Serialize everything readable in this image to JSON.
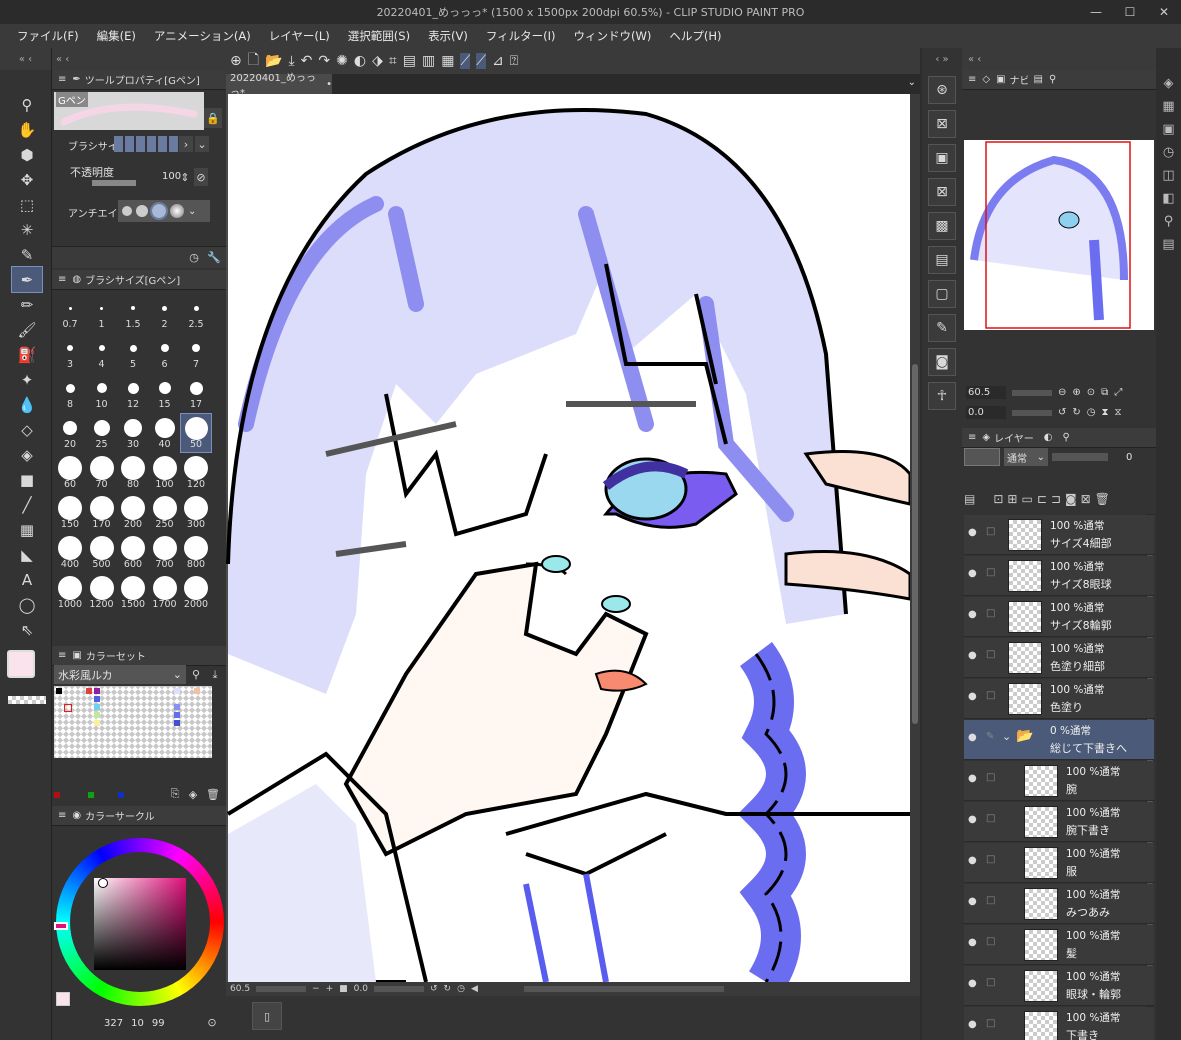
{
  "window": {
    "title": "20220401_めっっっ* (1500 x 1500px 200dpi 60.5%)  - CLIP STUDIO PAINT PRO"
  },
  "menu": [
    "ファイル(F)",
    "編集(E)",
    "アニメーション(A)",
    "レイヤー(L)",
    "選択範囲(S)",
    "表示(V)",
    "フィルター(I)",
    "ウィンドウ(W)",
    "ヘルプ(H)"
  ],
  "canvas_tab": {
    "label": "20220401_めっっっ*"
  },
  "tool_property": {
    "title": "ツールプロパティ[Gペン]",
    "preset_name": "Gペン",
    "brush_size_label": "ブラシサイズ",
    "opacity_label": "不透明度",
    "opacity_value": "100",
    "antialias_label": "アンチエイリアス"
  },
  "brush_size_panel": {
    "title": "ブラシサイズ[Gペン]",
    "sizes": [
      "0.7",
      "1",
      "1.5",
      "2",
      "2.5",
      "3",
      "4",
      "5",
      "6",
      "7",
      "8",
      "10",
      "12",
      "15",
      "17",
      "20",
      "25",
      "30",
      "40",
      "50",
      "60",
      "70",
      "80",
      "100",
      "120",
      "150",
      "170",
      "200",
      "250",
      "300",
      "400",
      "500",
      "600",
      "700",
      "800",
      "1000",
      "1200",
      "1500",
      "1700",
      "2000"
    ],
    "selected": "50"
  },
  "color_set": {
    "title": "カラーセット",
    "set_name": "水彩風ルカ"
  },
  "color_circle": {
    "title": "カラーサークル",
    "info": "327",
    "saturation": "10",
    "value": "99"
  },
  "navigator": {
    "tab": "ナビゲーター",
    "zoom": "60.5",
    "rotation": "0.0"
  },
  "layers": {
    "title": "レイヤー",
    "blend_mode": "通常",
    "opacity": "0",
    "items": [
      {
        "line1": "100 %通常",
        "line2": "サイズ4細部",
        "indent": false,
        "folder": false
      },
      {
        "line1": "100 %通常",
        "line2": "サイズ8眼球",
        "indent": false,
        "folder": false
      },
      {
        "line1": "100 %通常",
        "line2": "サイズ8輪郭",
        "indent": false,
        "folder": false
      },
      {
        "line1": "100 %通常",
        "line2": "色塗り細部",
        "indent": false,
        "folder": false
      },
      {
        "line1": "100 %通常",
        "line2": "色塗り",
        "indent": false,
        "folder": false
      },
      {
        "line1": "0 %通常",
        "line2": "総じて下書きへ",
        "indent": false,
        "folder": true
      },
      {
        "line1": "100 %通常",
        "line2": "腕",
        "indent": true,
        "folder": false
      },
      {
        "line1": "100 %通常",
        "line2": "腕下書き",
        "indent": true,
        "folder": false
      },
      {
        "line1": "100 %通常",
        "line2": "服",
        "indent": true,
        "folder": false
      },
      {
        "line1": "100 %通常",
        "line2": "みつあみ",
        "indent": true,
        "folder": false
      },
      {
        "line1": "100 %通常",
        "line2": "髪",
        "indent": true,
        "folder": false
      },
      {
        "line1": "100 %通常",
        "line2": "眼球・輪郭",
        "indent": true,
        "folder": false
      },
      {
        "line1": "100 %通常",
        "line2": "下書き",
        "indent": true,
        "folder": false
      }
    ]
  },
  "status": {
    "zoom": "60.5",
    "angle": "0.0"
  },
  "colors": {
    "accent": "#4a5a78",
    "main_color": "#fbe3ee",
    "sub_color": "#000000"
  }
}
